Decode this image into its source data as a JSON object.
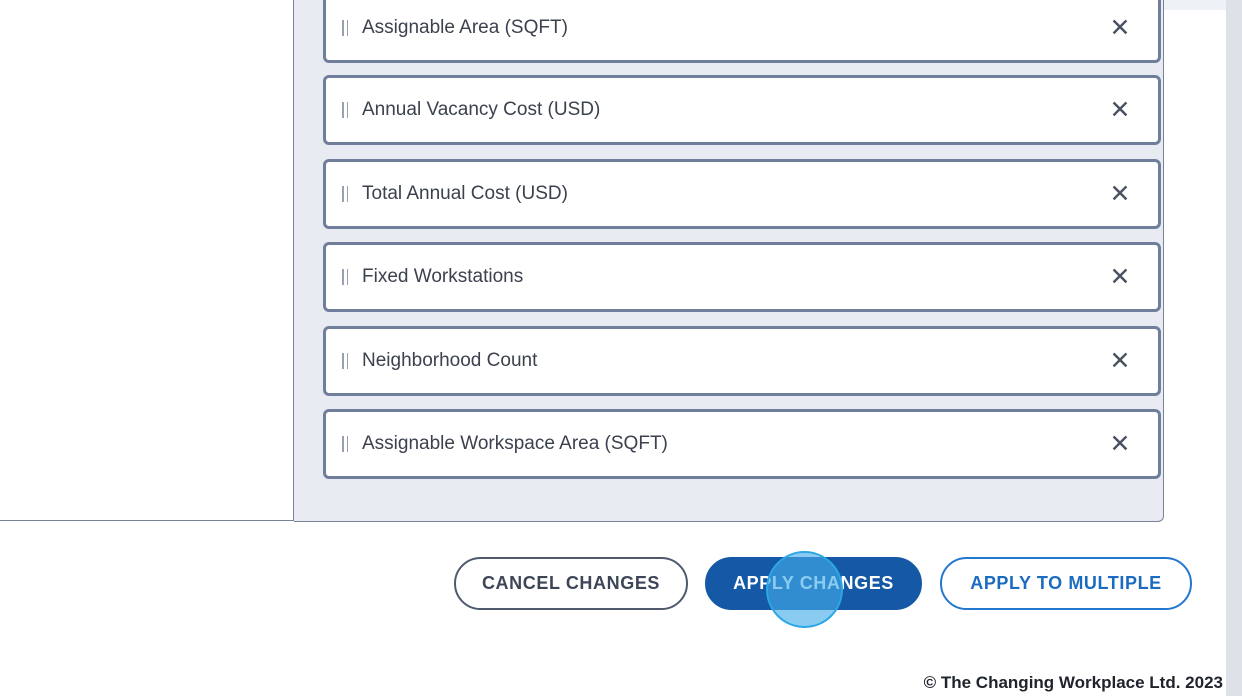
{
  "fields": [
    {
      "label": "Assignable Area (SQFT)",
      "remove": "✕"
    },
    {
      "label": "Annual Vacancy Cost (USD)",
      "remove": "✕"
    },
    {
      "label": "Total Annual Cost (USD)",
      "remove": "✕"
    },
    {
      "label": "Fixed Workstations",
      "remove": "✕"
    },
    {
      "label": "Neighborhood Count",
      "remove": "✕"
    },
    {
      "label": "Assignable Workspace Area (SQFT)",
      "remove": "✕"
    }
  ],
  "icons": {
    "drag": "drag-handle-icon",
    "remove": "close-icon"
  },
  "actions": {
    "cancel_label": "CANCEL CHANGES",
    "apply_label": "APPLY CHANGES",
    "apply_multiple_label": "APPLY TO MULTIPLE"
  },
  "footer": {
    "copyright": "© The Changing Workplace Ltd. 2023"
  },
  "colors": {
    "primary": "#1559a6",
    "outline_blue": "#2477cf",
    "panel_background": "#e8ebf1",
    "field_border": "#6f7f9b",
    "click_indicator": "#42ade8"
  }
}
